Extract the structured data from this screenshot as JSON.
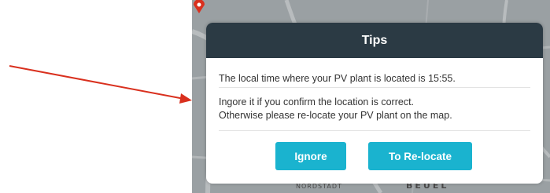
{
  "dialog": {
    "title": "Tips",
    "time_message": "The local time where your PV plant is located is 15:55.",
    "confirm_message": "Ingore it if you confirm the location is correct.",
    "relocate_message": "Otherwise please re-locate your PV plant on the map.",
    "ignore_label": "Ignore",
    "relocate_label": "To Re-locate"
  },
  "map": {
    "label_nordstadt": "NORDSTADT",
    "label_beuel": "BEUEL"
  },
  "colors": {
    "header_bg": "#2b3a44",
    "button_bg": "#1ab3cf",
    "arrow": "#d9301e"
  }
}
